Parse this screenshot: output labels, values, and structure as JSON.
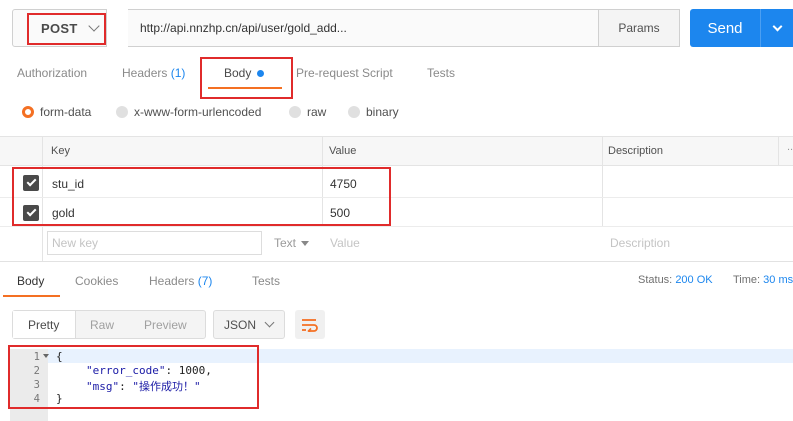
{
  "request": {
    "method": "POST",
    "url": "http://api.nnzhp.cn/api/user/gold_add...",
    "params_label": "Params",
    "send_label": "Send"
  },
  "request_tabs": {
    "authorization": "Authorization",
    "headers": "Headers",
    "headers_count": "(1)",
    "body": "Body",
    "prerequest": "Pre-request Script",
    "tests": "Tests"
  },
  "body_types": [
    "form-data",
    "x-www-form-urlencoded",
    "raw",
    "binary"
  ],
  "body_type_selected": "form-data",
  "kv_table": {
    "headers": [
      "Key",
      "Value",
      "Description"
    ],
    "rows": [
      {
        "checked": true,
        "key": "stu_id",
        "value": "4750"
      },
      {
        "checked": true,
        "key": "gold",
        "value": "500"
      }
    ],
    "new_key_placeholder": "New key",
    "type_select": "Text",
    "value_placeholder": "Value",
    "description_placeholder": "Description",
    "more": "..."
  },
  "response_tabs": {
    "body": "Body",
    "cookies": "Cookies",
    "headers": "Headers",
    "headers_count": "(7)",
    "tests": "Tests"
  },
  "status": {
    "status_label": "Status:",
    "status_value": "200 OK",
    "time_label": "Time:",
    "time_value": "30 ms"
  },
  "view_modes": [
    "Pretty",
    "Raw",
    "Preview"
  ],
  "view_mode_selected": "Pretty",
  "format_select": "JSON",
  "response_lines": [
    {
      "num": "1",
      "text": "{"
    },
    {
      "num": "2",
      "key": "\"error_code\"",
      "rest": ": 1000,"
    },
    {
      "num": "3",
      "key": "\"msg\"",
      "rest": ": ",
      "str": "\"操作成功！\""
    },
    {
      "num": "4",
      "text": "}"
    }
  ],
  "colors": {
    "accent": "#1c86ee",
    "tab_active": "#f47023",
    "annotation": "#e02b2b"
  }
}
